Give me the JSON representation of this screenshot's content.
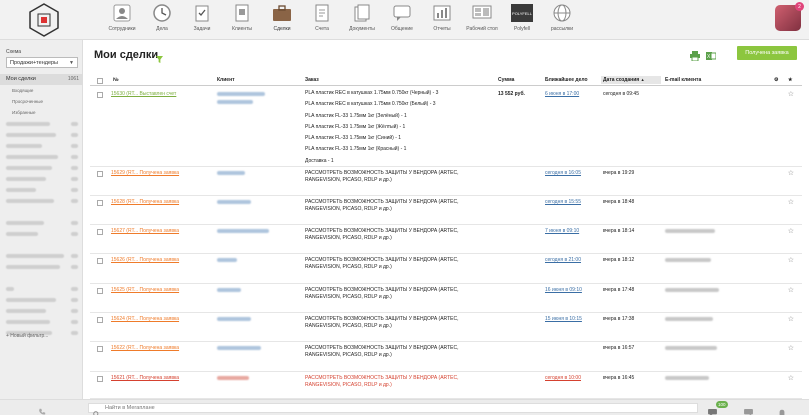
{
  "nav": [
    {
      "label": "Сотрудники",
      "icon": "employees-icon"
    },
    {
      "label": "Дела",
      "icon": "clock-icon"
    },
    {
      "label": "Задачи",
      "icon": "tasks-icon"
    },
    {
      "label": "Клиенты",
      "icon": "clients-icon"
    },
    {
      "label": "Сделки",
      "icon": "briefcase-icon"
    },
    {
      "label": "Счета",
      "icon": "invoice-icon"
    },
    {
      "label": "Документы",
      "icon": "documents-icon"
    },
    {
      "label": "Общение",
      "icon": "chat-icon"
    },
    {
      "label": "Отчеты",
      "icon": "reports-icon"
    },
    {
      "label": "Рабочий стол",
      "icon": "desktop-icon"
    },
    {
      "label": "Polyfell",
      "icon": "polyfell-icon",
      "logo_text": "POLYFELL"
    },
    {
      "label": "рассылки",
      "icon": "globe-icon"
    }
  ],
  "avatar_badge": "2",
  "sidebar": {
    "schema_label": "Схема",
    "schema_value": "Продажи+тендеры",
    "active_item": {
      "label": "Мои сделки",
      "count": "1061"
    },
    "sub_items": [
      "Входящие",
      "Просроченные",
      "Избранные"
    ],
    "new_filter": "+ Новый фильтр..."
  },
  "page_title": "Мои сделки",
  "status_button": "Получена заявка",
  "columns": {
    "num": "№",
    "client": "Клиент",
    "order": "Заказ",
    "sum": "Сумма",
    "next_task": "Ближайшее дело",
    "created": "Дата создания",
    "email": "E-mail клиента"
  },
  "rows": [
    {
      "deal": "15630 (RT... Выставлен счет",
      "deal_color": "green",
      "order_lines": [
        "PLA пластик REC в катушках 1.75мм 0.750кг (Черный) - 3",
        "PLA пластик REC в катушках 1.75мм 0.750кг (Белый) - 3",
        "PLA пластик FL-33 1.75мм 1кг (Зелёный) - 1",
        "PLA пластик FL-33 1.75мм 1кг (Жёлтый) - 1",
        "PLA пластик FL-33 1.75мм 1кг (Синий) - 1",
        "PLA пластик FL-33 1.75мм 1кг (Красный) - 1",
        "Доставка - 1"
      ],
      "sum": "13 552 руб.",
      "next_task": "6 июня в 17:00",
      "created": "сегодня в 09:45"
    },
    {
      "deal": "15629 (RT... Получена заявка",
      "deal_color": "orange",
      "order_lines": [
        "РАССМОТРЕТЬ ВОЗМОЖНОСТЬ ЗАЩИТЫ У ВЕНДОРА (ARTEC,",
        "RANGEVISION, PICASO, RDLP и др.)"
      ],
      "sum": "",
      "next_task": "сегодня в 16:05",
      "created": "вчера в 19:29"
    },
    {
      "deal": "15628 (RT... Получена заявка",
      "deal_color": "orange",
      "order_lines": [
        "РАССМОТРЕТЬ ВОЗМОЖНОСТЬ ЗАЩИТЫ У ВЕНДОРА (ARTEC,",
        "RANGEVISION, PICASO, RDLP и др.)"
      ],
      "sum": "",
      "next_task": "сегодня в 15:55",
      "created": "вчера в 18:48"
    },
    {
      "deal": "15627 (RT... Получена заявка",
      "deal_color": "orange",
      "order_lines": [
        "РАССМОТРЕТЬ ВОЗМОЖНОСТЬ ЗАЩИТЫ У ВЕНДОРА (ARTEC,",
        "RANGEVISION, PICASO, RDLP и др.)"
      ],
      "sum": "",
      "next_task": "7 июня в 09:10",
      "created": "вчера в 18:14"
    },
    {
      "deal": "15626 (RT... Получена заявка",
      "deal_color": "orange",
      "order_lines": [
        "РАССМОТРЕТЬ ВОЗМОЖНОСТЬ ЗАЩИТЫ У ВЕНДОРА (ARTEC,",
        "RANGEVISION, PICASO, RDLP и др.)"
      ],
      "sum": "",
      "next_task": "сегодня в 21:00",
      "created": "вчера в 18:12"
    },
    {
      "deal": "15625 (RT... Получена заявка",
      "deal_color": "orange",
      "order_lines": [
        "РАССМОТРЕТЬ ВОЗМОЖНОСТЬ ЗАЩИТЫ У ВЕНДОРА (ARTEC,",
        "RANGEVISION, PICASO, RDLP и др.)"
      ],
      "sum": "",
      "next_task": "16 июня в 09:10",
      "created": "вчера в 17:48"
    },
    {
      "deal": "15624 (RT... Получена заявка",
      "deal_color": "orange",
      "order_lines": [
        "РАССМОТРЕТЬ ВОЗМОЖНОСТЬ ЗАЩИТЫ У ВЕНДОРА (ARTEC,",
        "RANGEVISION, PICASO, RDLP и др.)"
      ],
      "sum": "",
      "next_task": "15 июня в 10:15",
      "created": "вчера в 17:38"
    },
    {
      "deal": "15622 (RT... Получена заявка",
      "deal_color": "orange",
      "order_lines": [
        "РАССМОТРЕТЬ ВОЗМОЖНОСТЬ ЗАЩИТЫ У ВЕНДОРА (ARTEC,",
        "RANGEVISION, PICASO, RDLP и др.)"
      ],
      "sum": "",
      "next_task": "",
      "created": "вчера в 16:57"
    },
    {
      "deal": "15621 (RT... Получена заявка",
      "deal_color": "red",
      "order_lines": [
        "РАССМОТРЕТЬ ВОЗМОЖНОСТЬ ЗАЩИТЫ У ВЕНДОРА (ARTEC,",
        "RANGEVISION, PICASO, RDLP и др.)"
      ],
      "sum": "",
      "next_task": "сегодня в 10:00",
      "created": "вчера в 16:45"
    }
  ],
  "search_placeholder": "Найти в Мегаплане",
  "chat_badge": "100"
}
